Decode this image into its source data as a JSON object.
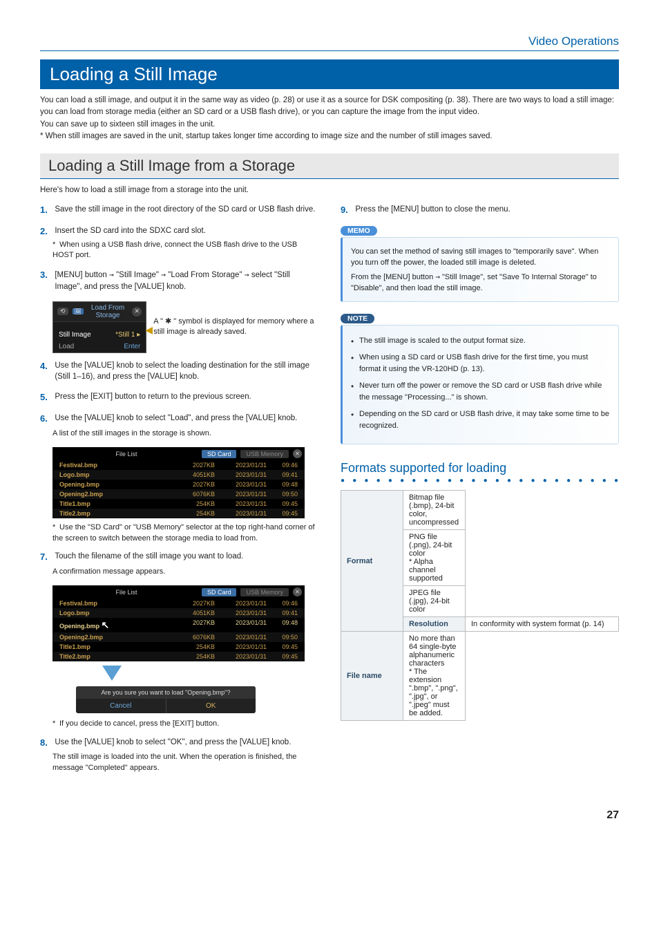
{
  "header": {
    "section": "Video Operations"
  },
  "title_bar": "Loading a Still Image",
  "intro": {
    "p1": "You can load a still image, and output it in the same way as video (p. 28) or use it as a source for DSK compositing (p. 38). There are two ways to load a still image: you can load from storage media (either an SD card or a USB flash drive), or you can capture the image from the input video.",
    "p2": "You can save up to sixteen still images in the unit.",
    "note": "When still images are saved in the unit, startup takes longer time according to image size and the number of still images saved."
  },
  "subsection": {
    "title": "Loading a Still Image from a Storage",
    "desc": "Here's how to load a still image from a storage into the unit."
  },
  "steps": {
    "s1": "Save the still image in the root directory of the SD card or USB flash drive.",
    "s2": "Insert the SD card into the SDXC card slot.",
    "s2_note": "When using a USB flash drive, connect the USB flash drive to the USB HOST port.",
    "s3_pre": "[MENU] button ",
    "s3_a": " \"Still Image\" ",
    "s3_b": " \"Load From Storage\" ",
    "s3_post": " select \"Still Image\", and press the [VALUE] knob.",
    "s3_side": "A \" ✱ \" symbol is displayed for memory where a still image is already saved.",
    "s4": "Use the [VALUE] knob to select the loading destination for the still image (Still 1–16), and press the [VALUE] knob.",
    "s5": "Press the [EXIT] button to return to the previous screen.",
    "s6": "Use the [VALUE] knob to select \"Load\", and press the [VALUE] knob.",
    "s6_sub": "A list of the still images in the storage is shown.",
    "s6_note": "Use the \"SD Card\" or \"USB Memory\" selector at the top right-hand corner of the screen to switch between the storage media to load from.",
    "s7": "Touch the filename of the still image you want to load.",
    "s7_sub": "A confirmation message appears.",
    "s7_note": "If you decide to cancel, press the [EXIT] button.",
    "s8": "Use the [VALUE] knob to select \"OK\", and press the [VALUE] knob.",
    "s8_sub": "The still image is loaded into the unit. When the operation is finished, the message \"Completed\" appears.",
    "s9": "Press the [MENU] button to close the menu."
  },
  "load_box": {
    "title": "Load From Storage",
    "row1_label": "Still Image",
    "row1_val": "*Still 1 ▸",
    "row2_label": "Load",
    "row2_val": "Enter"
  },
  "file_list": {
    "title": "File List",
    "tab_sd": "SD Card",
    "tab_usb": "USB Memory",
    "rows": [
      {
        "name": "Festival.bmp",
        "size": "2027KB",
        "date": "2023/01/31",
        "time": "09:46"
      },
      {
        "name": "Logo.bmp",
        "size": "4051KB",
        "date": "2023/01/31",
        "time": "09:41"
      },
      {
        "name": "Opening.bmp",
        "size": "2027KB",
        "date": "2023/01/31",
        "time": "09:48"
      },
      {
        "name": "Opening2.bmp",
        "size": "6076KB",
        "date": "2023/01/31",
        "time": "09:50"
      },
      {
        "name": "Title1.bmp",
        "size": "254KB",
        "date": "2023/01/31",
        "time": "09:45"
      },
      {
        "name": "Title2.bmp",
        "size": "254KB",
        "date": "2023/01/31",
        "time": "09:45"
      }
    ]
  },
  "confirm": {
    "head": "Are you sure you want to load \"Opening.bmp\"?",
    "cancel": "Cancel",
    "ok": "OK"
  },
  "memo": {
    "label": "MEMO",
    "p1": "You can set the method of saving still images to \"temporarily save\". When you turn off the power, the loaded still image is deleted.",
    "p2_pre": "From the [MENU] button ",
    "p2_post": " \"Still Image\", set \"Save To Internal Storage\" to \"Disable\", and then load the still image."
  },
  "note": {
    "label": "NOTE",
    "items": [
      "The still image is scaled to the output format size.",
      "When using a SD card or USB flash drive for the first time, you must format it using the VR-120HD (p. 13).",
      "Never turn off the power or remove the SD card or USB flash drive while the message \"Processing...\" is shown.",
      "Depending on the SD card or USB flash drive, it may take some time to be recognized."
    ]
  },
  "formats": {
    "title": "Formats supported for loading",
    "rows": {
      "format_label": "Format",
      "f1": "Bitmap file (.bmp), 24-bit color, uncompressed",
      "f2": "PNG file (.png), 24-bit color",
      "f2b": "* Alpha channel supported",
      "f3": "JPEG file (.jpg), 24-bit color",
      "resolution_label": "Resolution",
      "r1": "In conformity with system format (p. 14)",
      "filename_label": "File name",
      "n1": "No more than 64 single-byte alphanumeric characters",
      "n2": "* The extension \".bmp\", \".png\", \".jpg\", or \".jpeg\" must be added."
    }
  },
  "page_num": "27"
}
